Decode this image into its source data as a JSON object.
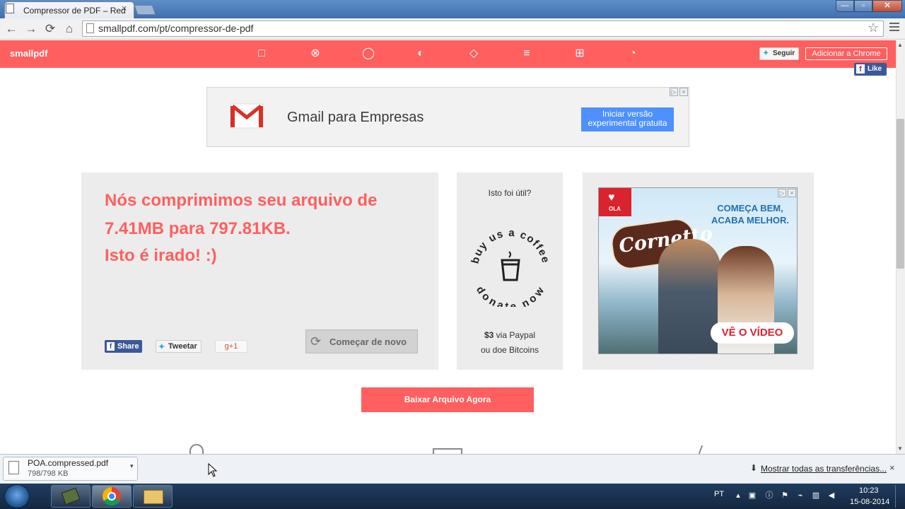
{
  "browser": {
    "tab_title": "Compressor de PDF – Red",
    "tab_close": "×",
    "url": "smallpdf.com/pt/compressor-de-pdf",
    "window_buttons": {
      "minimize": "—",
      "maximize": "▫",
      "close": "✕"
    }
  },
  "toolbar": {
    "back_icon": "←",
    "forward_icon": "→",
    "reload_icon": "⟳",
    "home_icon": "⌂",
    "star_icon": "☆"
  },
  "header": {
    "logo": "smallpdf",
    "tool_icons": [
      "□",
      "⊗",
      "◯",
      "◐",
      "◇",
      "≡",
      "⊞",
      "◔"
    ],
    "follow_label": "Seguir",
    "chrome_label": "Adicionar a Chrome",
    "like_label": "Like",
    "brand_color": "#ff5f5f"
  },
  "ad_top": {
    "text": "Gmail para Empresas",
    "cta": "Iniciar versão experimental gratuita"
  },
  "result": {
    "line1": "Nós comprimimos seu arquivo de",
    "line2": "7.41MB para 797.81KB.",
    "line3": "Isto é irado! :)",
    "share_fb": "Share",
    "share_tw": "Tweetar",
    "share_gp": "g+1",
    "restart": "Começar de novo"
  },
  "coffee": {
    "question": "Isto foi útil?",
    "badge_top": "buy us a coffee",
    "badge_bottom": "donate now",
    "amount": "$3",
    "line1_rest": " via Paypal",
    "line2": "ou doe Bitcoins"
  },
  "ad_right": {
    "brand": "Cornetto",
    "ola": "OLA",
    "slogan1": "COMEÇA BEM,",
    "slogan2": "ACABA MELHOR.",
    "cta": "VÊ O VÍDEO"
  },
  "download_button": "Baixar Arquivo Agora",
  "download_shelf": {
    "file_name": "POA.compressed.pdf",
    "file_size": "798/798 KB",
    "show_all": "Mostrar todas as  transferências...",
    "close": "×"
  },
  "taskbar": {
    "lang": "PT",
    "time": "10:23",
    "date": "15-08-2014"
  }
}
